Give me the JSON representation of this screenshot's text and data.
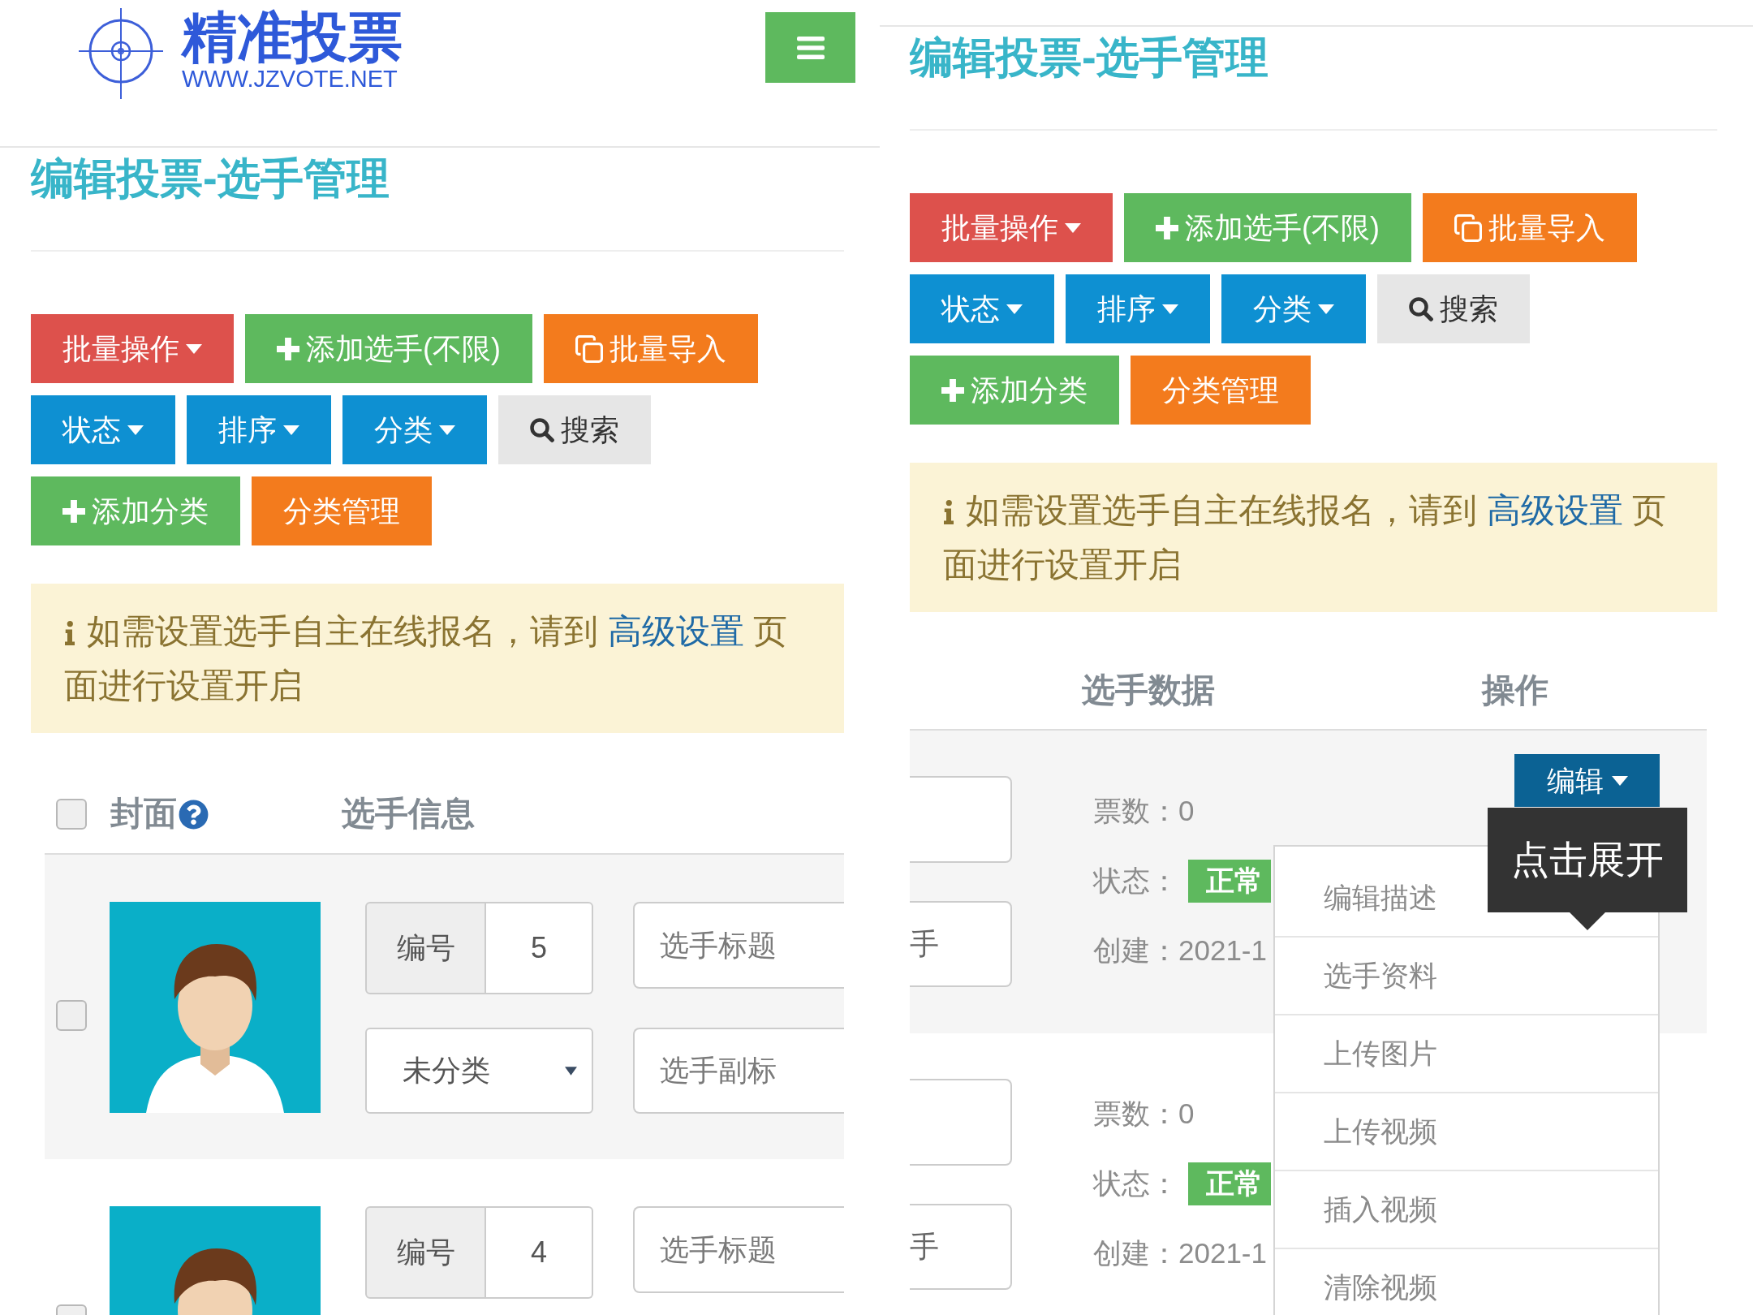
{
  "left_screen": {
    "header": {
      "logo_title": "精准投票",
      "logo_url": "WWW.JZVOTE.NET"
    },
    "page_title": "编辑投票-选手管理",
    "toolbar": [
      {
        "buttons": [
          {
            "label": "批量操作",
            "kind": "dropdown",
            "color": "#dd514c"
          },
          {
            "label": "添加选手(不限)",
            "kind": "add",
            "color": "#5eb95e"
          },
          {
            "label": "批量导入",
            "kind": "import",
            "color": "#f37b1d"
          }
        ]
      },
      {
        "buttons": [
          {
            "label": "状态",
            "kind": "dropdown",
            "color": "#0e90d2"
          },
          {
            "label": "排序",
            "kind": "dropdown",
            "color": "#0e90d2"
          },
          {
            "label": "分类",
            "kind": "dropdown",
            "color": "#0e90d2"
          },
          {
            "label": "搜索",
            "kind": "search",
            "color": "#e6e6e6"
          }
        ]
      },
      {
        "buttons": [
          {
            "label": "添加分类",
            "kind": "add",
            "color": "#5eb95e"
          },
          {
            "label": "分类管理",
            "kind": "plain",
            "color": "#f37b1d"
          }
        ]
      }
    ],
    "notice": {
      "text": "如需设置选手自主在线报名，请到 ",
      "link": "高级设置",
      "text_after": " 页面进行设置开启"
    },
    "table": {
      "select_all_checked": false,
      "columns": [
        {
          "label": "封面",
          "kind": "help"
        },
        {
          "label": "选手信息",
          "kind": "plain"
        }
      ],
      "rows": [
        {
          "checked": false,
          "number_label": "编号",
          "number": "5",
          "category": "未分类",
          "title_placeholder": "选手标题",
          "subtitle_placeholder": "选手副标"
        },
        {
          "checked": false,
          "number_label": "编号",
          "number": "4",
          "title_placeholder": "选手标题"
        }
      ]
    }
  },
  "right_screen": {
    "page_title": "编辑投票-选手管理",
    "toolbar": [
      {
        "buttons": [
          {
            "label": "批量操作",
            "kind": "dropdown",
            "color": "#dd514c"
          },
          {
            "label": "添加选手(不限)",
            "kind": "add",
            "color": "#5eb95e"
          },
          {
            "label": "批量导入",
            "kind": "import",
            "color": "#f37b1d"
          }
        ]
      },
      {
        "buttons": [
          {
            "label": "状态",
            "kind": "dropdown",
            "color": "#0e90d2"
          },
          {
            "label": "排序",
            "kind": "dropdown",
            "color": "#0e90d2"
          },
          {
            "label": "分类",
            "kind": "dropdown",
            "color": "#0e90d2"
          },
          {
            "label": "搜索",
            "kind": "search",
            "color": "#e6e6e6"
          }
        ]
      },
      {
        "buttons": [
          {
            "label": "添加分类",
            "kind": "add",
            "color": "#5eb95e"
          },
          {
            "label": "分类管理",
            "kind": "plain",
            "color": "#f37b1d"
          }
        ]
      }
    ],
    "notice": {
      "text": "如需设置选手自主在线报名，请到 ",
      "link": "高级设置",
      "text_after": " 页面进行设置开启"
    },
    "table": {
      "columns": [
        "选手数据",
        "操作"
      ],
      "rows": [
        {
          "field_placeholder": "手",
          "votes_label": "票数：",
          "votes": "0",
          "status_label": "状态：",
          "status": "正常",
          "created_label": "创建：",
          "created": "2021-1",
          "action": {
            "label": "编辑",
            "expanded": true,
            "menu": [
              "编辑描述",
              "选手资料",
              "上传图片",
              "上传视频",
              "插入视频",
              "清除视频"
            ],
            "tooltip": "点击展开"
          }
        },
        {
          "field_placeholder": "手",
          "votes_label": "票数：",
          "votes": "0",
          "status_label": "状态：",
          "status": "正常",
          "created_label": "创建：",
          "created": "2021-1"
        }
      ]
    }
  }
}
